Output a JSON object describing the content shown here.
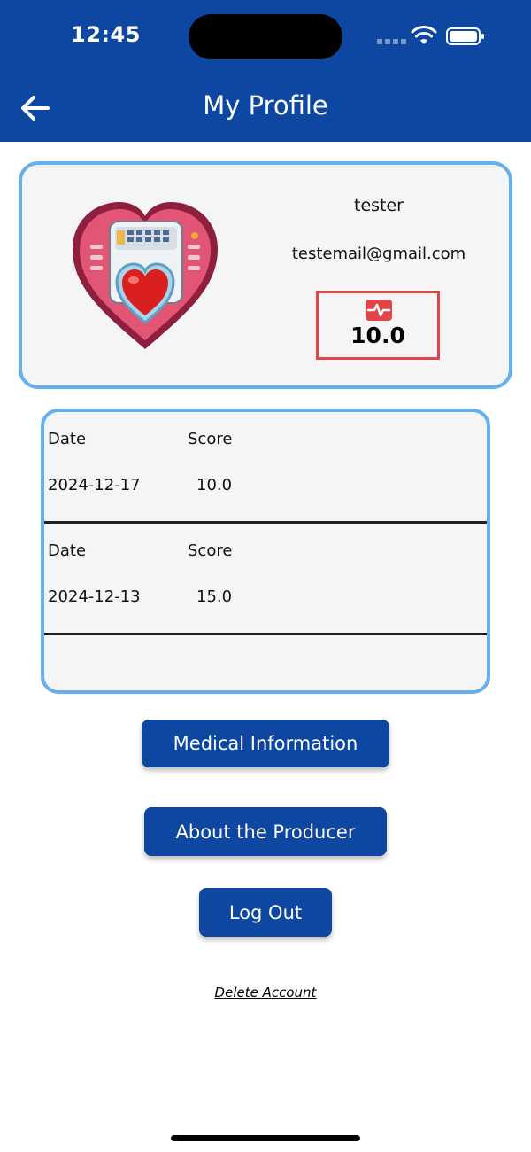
{
  "status_bar": {
    "time": "12:45",
    "icons": [
      "cellular-signal-icon",
      "wifi-icon",
      "battery-icon"
    ]
  },
  "header": {
    "title": "My Profile",
    "back_icon": "arrow-left-icon"
  },
  "profile": {
    "username": "tester",
    "email": "testemail@gmail.com",
    "avatar_icon": "heart-device-avatar",
    "score_icon": "heart-pulse-icon",
    "score": "10.0"
  },
  "history": {
    "rows": [
      {
        "date_header": "Date",
        "score_header": "Score",
        "date": "2024-12-17",
        "score": "10.0"
      },
      {
        "date_header": "Date",
        "score_header": "Score",
        "date": "2024-12-13",
        "score": "15.0"
      }
    ]
  },
  "actions": {
    "medical_info_label": "Medical Information",
    "about_producer_label": "About the Producer",
    "log_out_label": "Log Out",
    "delete_account_label": "Delete Account"
  },
  "colors": {
    "header_bg": "#0d47a1",
    "button_bg": "#0d47a1",
    "card_border": "#64b0ee",
    "card_bg": "#f5f5f5",
    "score_border": "#e0454a"
  }
}
